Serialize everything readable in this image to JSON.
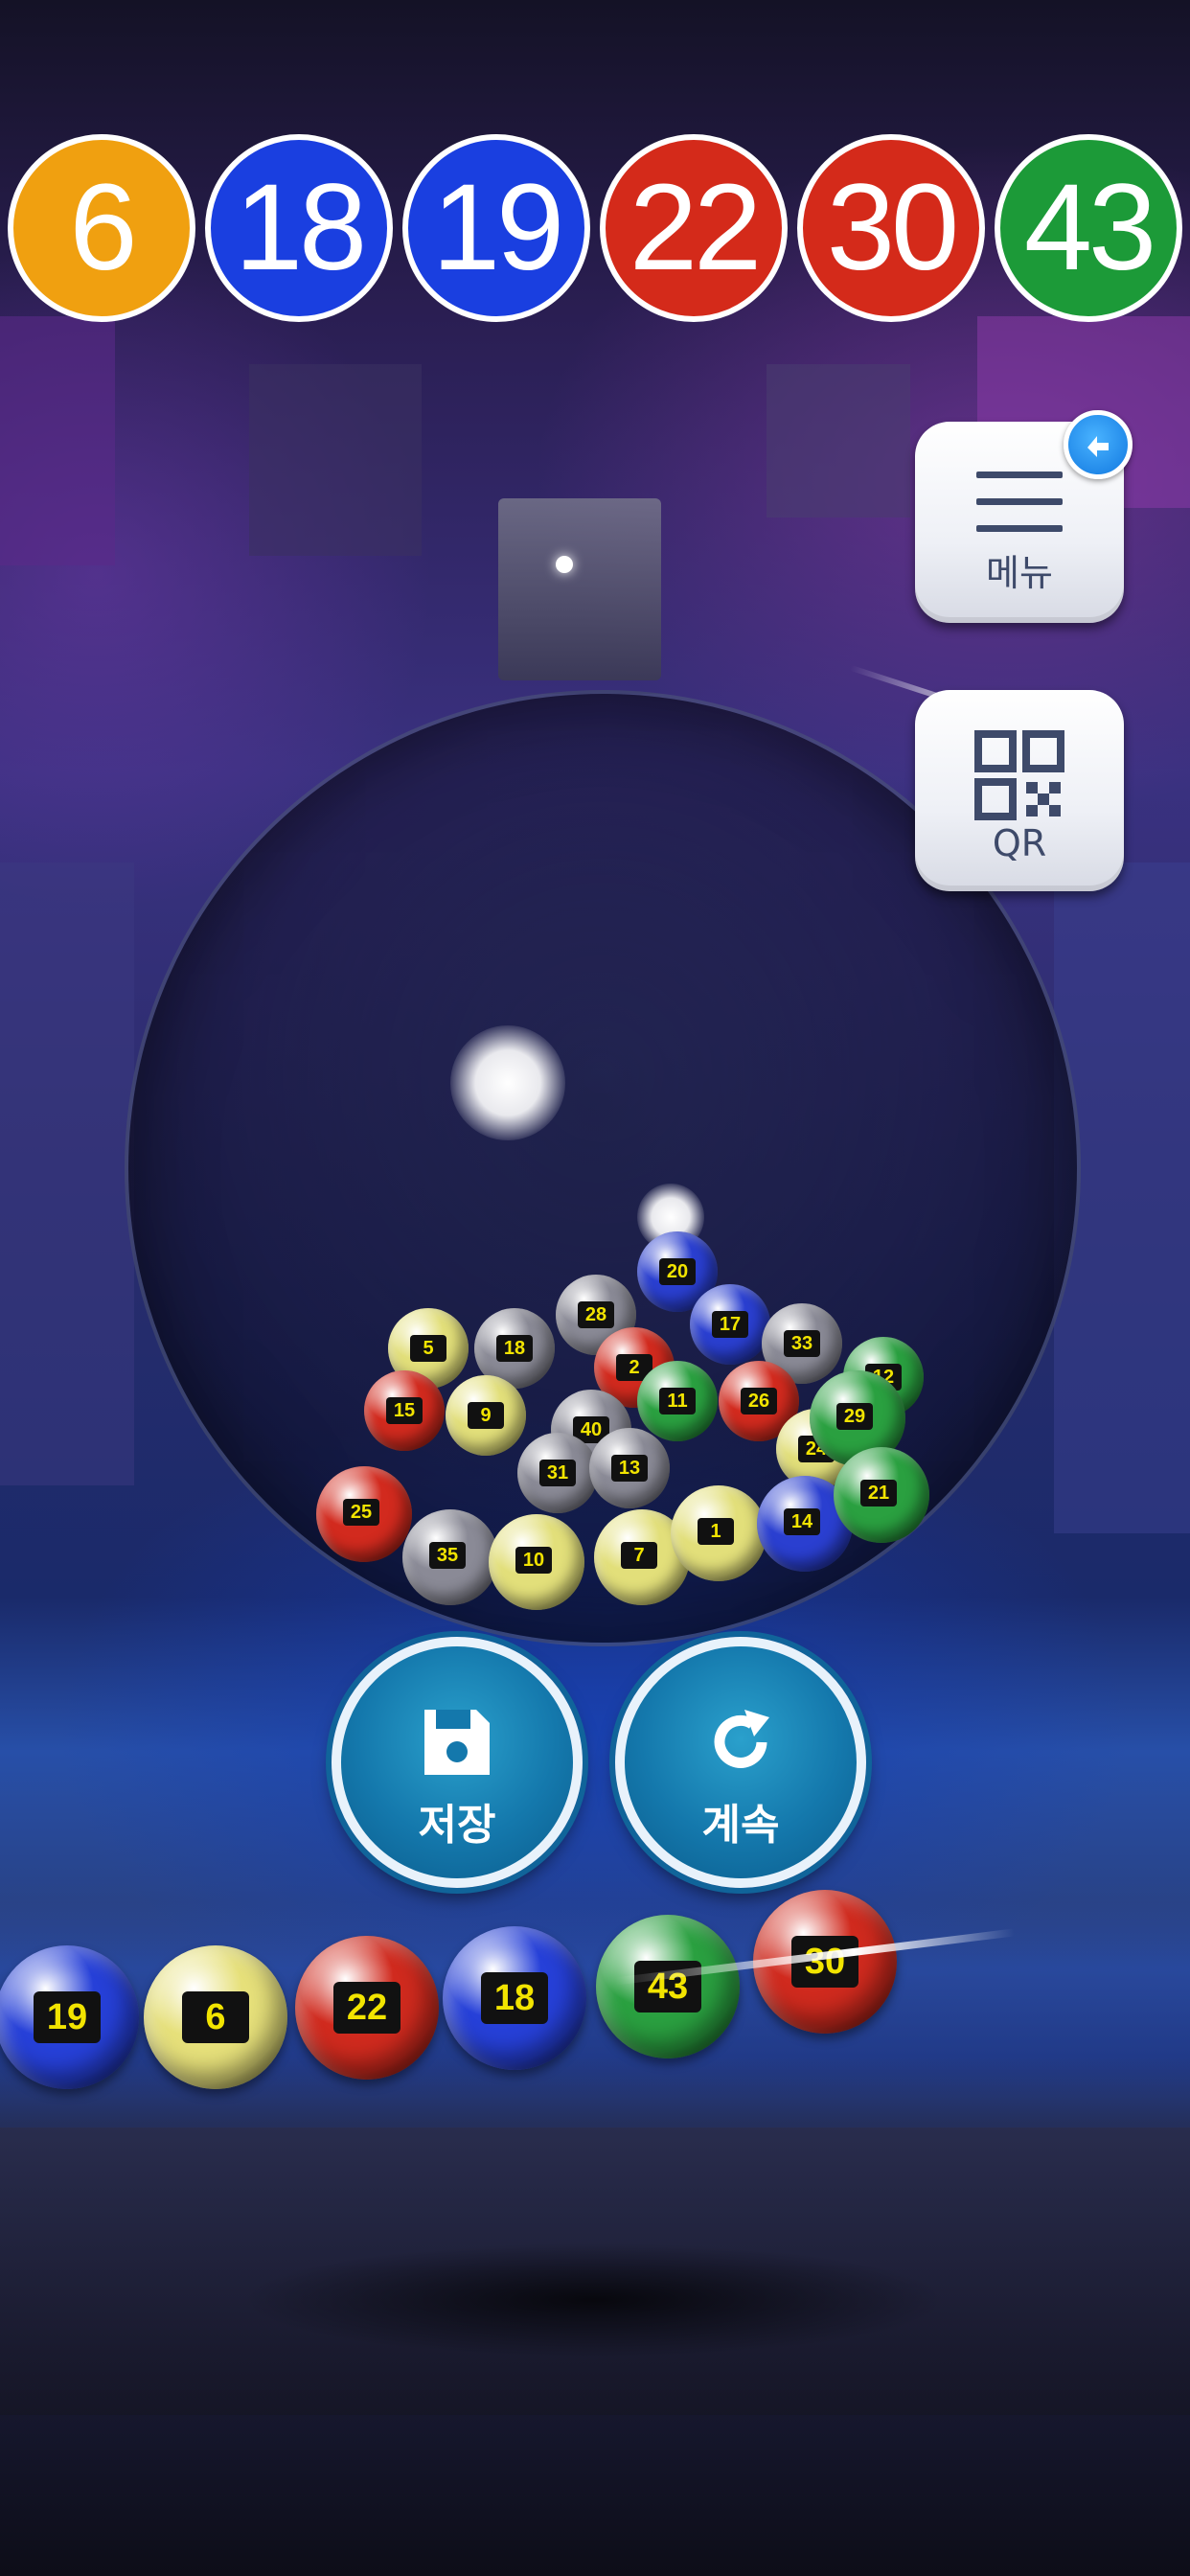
{
  "drawn_numbers": [
    {
      "number": "6",
      "color": "#f0a010"
    },
    {
      "number": "18",
      "color": "#1a3fe0"
    },
    {
      "number": "19",
      "color": "#1a3fe0"
    },
    {
      "number": "22",
      "color": "#d42a1a"
    },
    {
      "number": "30",
      "color": "#d42a1a"
    },
    {
      "number": "43",
      "color": "#1c9a38"
    }
  ],
  "side_buttons": {
    "menu": {
      "label": "메뉴",
      "icon": "hamburger-icon",
      "badge_icon": "refresh-badge-icon"
    },
    "qr": {
      "label": "QR",
      "icon": "qr-code-icon"
    }
  },
  "action_buttons": {
    "save": {
      "label": "저장",
      "icon": "floppy-disk-icon"
    },
    "continue": {
      "label": "계속",
      "icon": "refresh-icon"
    }
  },
  "track_balls": [
    {
      "number": "19",
      "color": "#2640d8"
    },
    {
      "number": "6",
      "color": "#e6e07a"
    },
    {
      "number": "22",
      "color": "#d02a1e"
    },
    {
      "number": "18",
      "color": "#2640d8"
    },
    {
      "number": "43",
      "color": "#2aa040"
    },
    {
      "number": "30",
      "color": "#d02a1e"
    }
  ],
  "drum_balls": [
    {
      "number": "20",
      "color": "#2a3fd0"
    },
    {
      "number": "28",
      "color": "#8a8a96"
    },
    {
      "number": "17",
      "color": "#2a3fd0"
    },
    {
      "number": "33",
      "color": "#8a8a96"
    },
    {
      "number": "5",
      "color": "#e2df7a"
    },
    {
      "number": "18",
      "color": "#8a8a96"
    },
    {
      "number": "2",
      "color": "#d22a1e"
    },
    {
      "number": "12",
      "color": "#2aa040"
    },
    {
      "number": "15",
      "color": "#d22a1e"
    },
    {
      "number": "9",
      "color": "#e2df7a"
    },
    {
      "number": "40",
      "color": "#8a8a96"
    },
    {
      "number": "11",
      "color": "#2aa040"
    },
    {
      "number": "26",
      "color": "#d22a1e"
    },
    {
      "number": "31",
      "color": "#8a8a96"
    },
    {
      "number": "13",
      "color": "#8a8a96"
    },
    {
      "number": "24",
      "color": "#e2df7a"
    },
    {
      "number": "35",
      "color": "#8a8a96"
    },
    {
      "number": "10",
      "color": "#e2df7a"
    },
    {
      "number": "7",
      "color": "#e2df7a"
    },
    {
      "number": "1",
      "color": "#e2df7a"
    },
    {
      "number": "14",
      "color": "#2a3fd0"
    },
    {
      "number": "25",
      "color": "#d22a1e"
    },
    {
      "number": "29",
      "color": "#2aa040"
    },
    {
      "number": "21",
      "color": "#2aa040"
    }
  ]
}
